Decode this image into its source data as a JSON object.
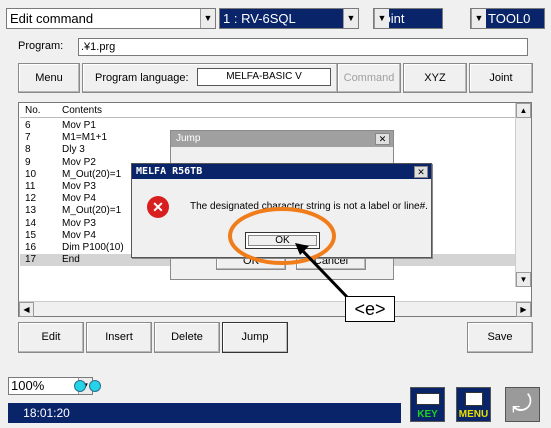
{
  "topbar": {
    "mode": "Edit command",
    "robot": "1 : RV-6SQL",
    "coord": "Joint",
    "tool": "TOOL0"
  },
  "program": {
    "label": "Program:",
    "value": ".¥1.prg"
  },
  "toolbar": {
    "menu": "Menu",
    "language_label": "Program language:",
    "language_value": "MELFA-BASIC V",
    "command": "Command",
    "xyz": "XYZ",
    "joint": "Joint"
  },
  "list": {
    "headers": [
      "No.",
      "Contents"
    ],
    "rows": [
      {
        "no": "6",
        "content": "Mov P1"
      },
      {
        "no": "7",
        "content": "M1=M1+1"
      },
      {
        "no": "8",
        "content": "Dly 3"
      },
      {
        "no": "9",
        "content": "Mov P2"
      },
      {
        "no": "10",
        "content": "M_Out(20)=1"
      },
      {
        "no": "11",
        "content": "Mov P3"
      },
      {
        "no": "12",
        "content": "Mov P4"
      },
      {
        "no": "13",
        "content": "M_Out(20)=1"
      },
      {
        "no": "14",
        "content": "Mov P3"
      },
      {
        "no": "15",
        "content": "Mov P4"
      },
      {
        "no": "16",
        "content": "Dim P100(10)"
      },
      {
        "no": "17",
        "content": "End"
      }
    ]
  },
  "jump_dialog": {
    "title": "Jump",
    "ok": "OK",
    "cancel": "Cancel"
  },
  "error_dialog": {
    "title": "MELFA R56TB",
    "message": "The designated character string is not a label or line#.",
    "ok": "OK"
  },
  "callout": "<e>",
  "bottom_buttons": {
    "edit": "Edit",
    "insert": "Insert",
    "delete": "Delete",
    "jump": "Jump",
    "save": "Save"
  },
  "status": {
    "zoom": "100%",
    "time": "18:01:20",
    "key_label": "KEY",
    "menu_label": "MENU"
  },
  "colors": {
    "selection_blue": "#0a246a",
    "highlight_orange": "#f07d1a",
    "key_green": "#1fd11f",
    "menu_yellow": "#e8e000"
  }
}
